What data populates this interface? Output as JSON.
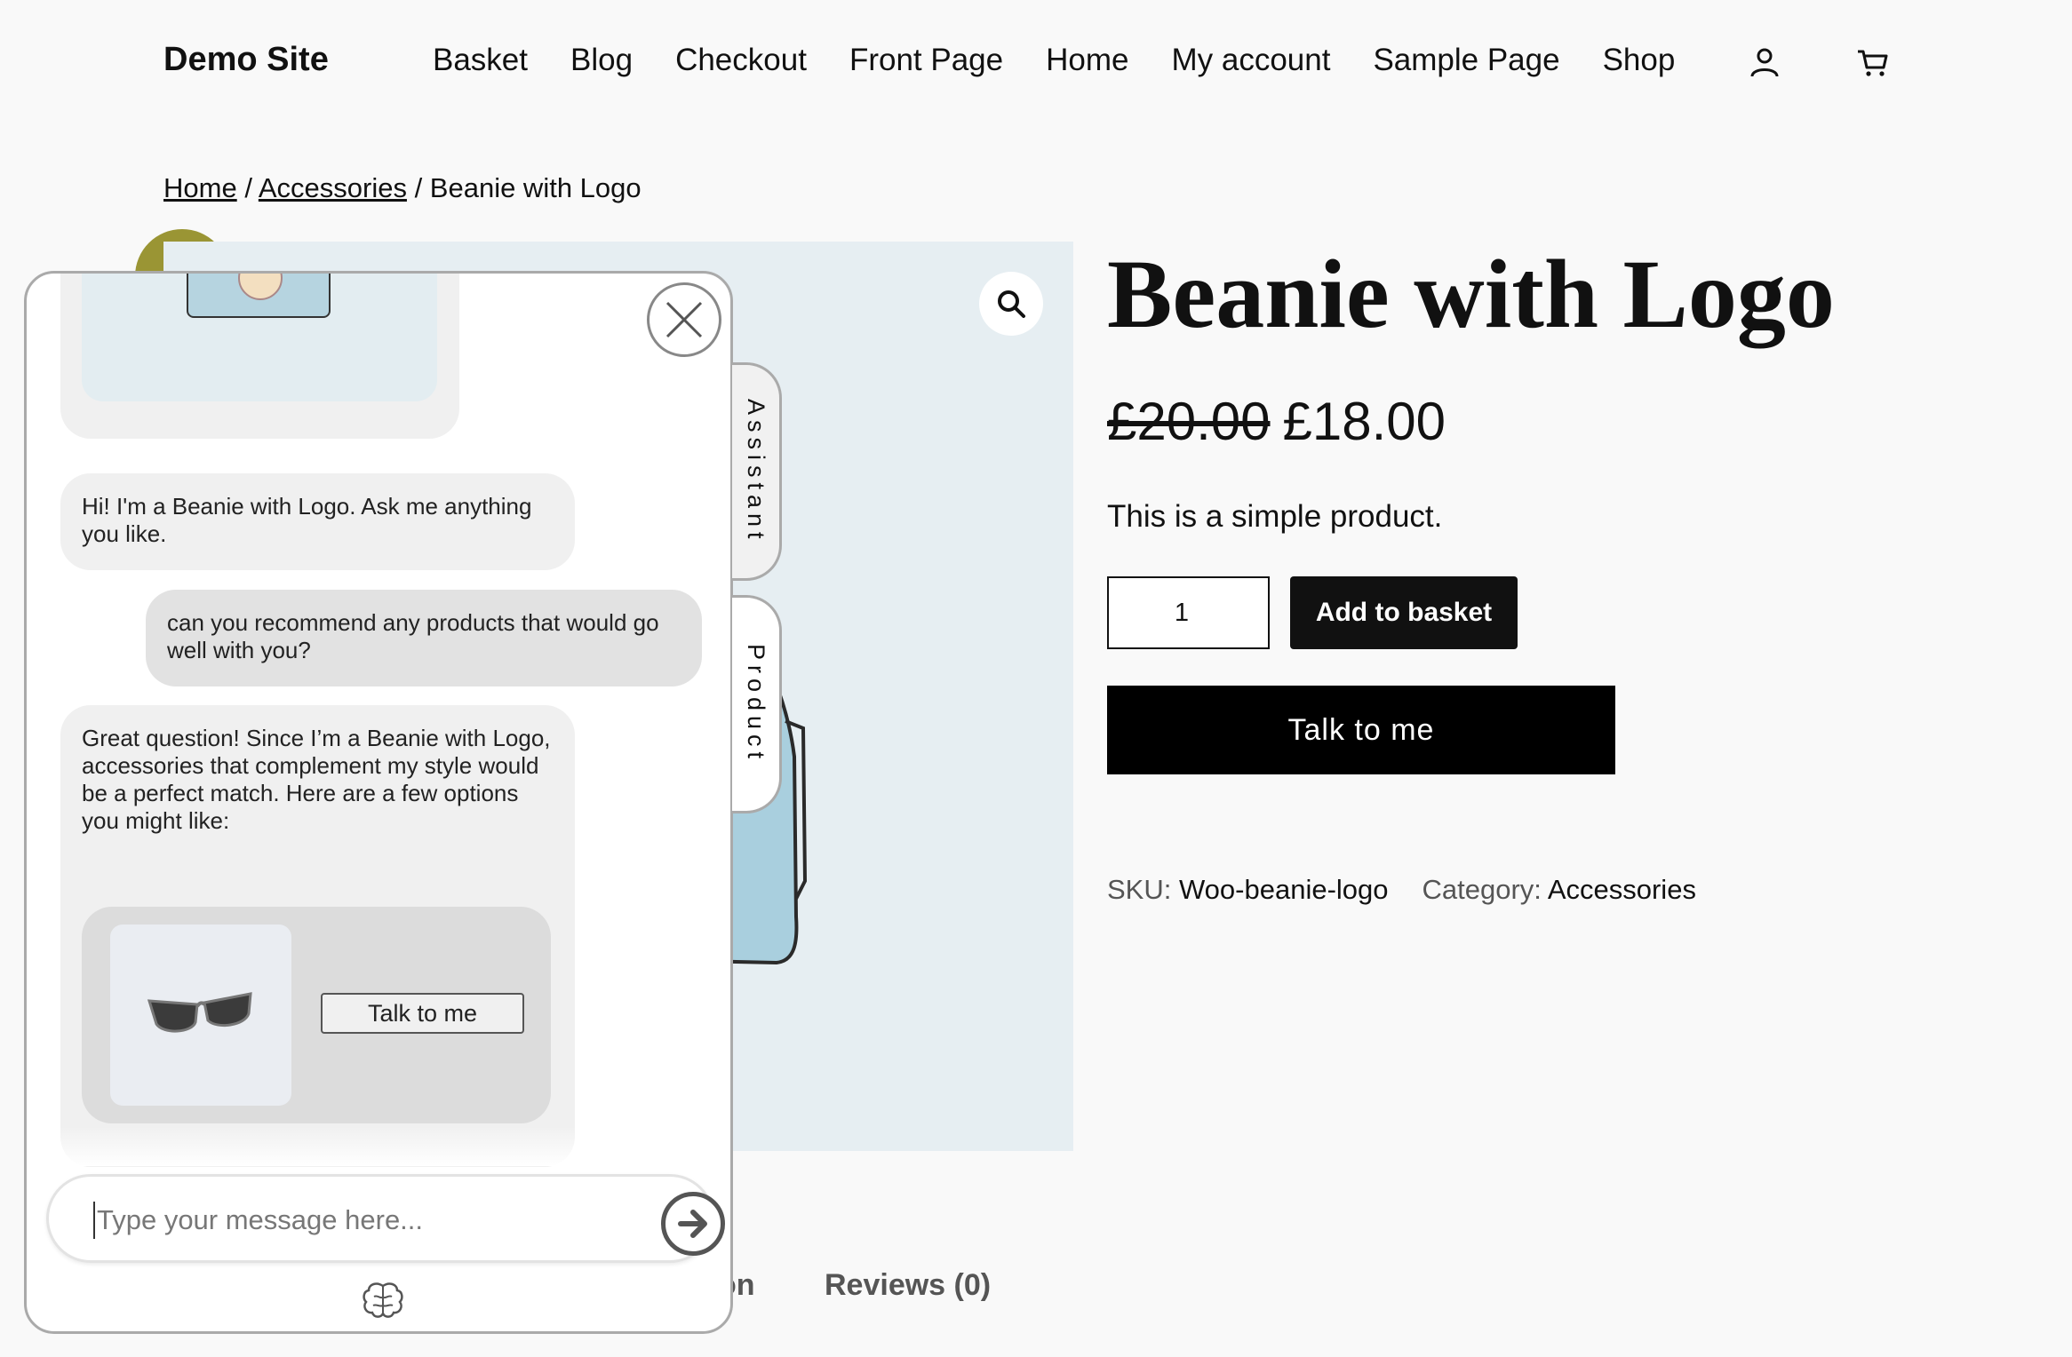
{
  "header": {
    "site_title": "Demo Site",
    "nav": [
      "Basket",
      "Blog",
      "Checkout",
      "Front Page",
      "Home",
      "My account",
      "Sample Page",
      "Shop"
    ],
    "account_icon": "user-icon",
    "cart_icon": "cart-icon"
  },
  "breadcrumb": {
    "home": "Home",
    "sep1": " / ",
    "category": "Accessories",
    "sep2": " / ",
    "current": "Beanie with Logo"
  },
  "product": {
    "title": "Beanie with Logo",
    "old_price": "£20.00",
    "price": "£18.00",
    "short_description": "This is a simple product.",
    "quantity": "1",
    "add_to_basket": "Add to basket",
    "talk_button": "Talk to me",
    "sku_label": "SKU:",
    "sku": "Woo-beanie-logo",
    "category_label": "Category:",
    "category": "Accessories"
  },
  "tabs": {
    "description_fragment": "on",
    "reviews": "Reviews (0)"
  },
  "chat": {
    "side_tabs": {
      "assistant": "Assistant",
      "product": "Product"
    },
    "messages": [
      {
        "role": "bot",
        "text": "Hi! I'm a Beanie with Logo. Ask me anything you like."
      },
      {
        "role": "user",
        "text": "can you recommend any products that would go well with you?"
      },
      {
        "role": "bot",
        "text": "Great question! Since I’m a Beanie with Logo, accessories that complement my style would be a perfect match. Here are a few options you might like:"
      }
    ],
    "suggestion_button": "Talk to me",
    "input_placeholder": "Type your message here...",
    "icons": {
      "close": "close-icon",
      "send": "arrow-right-icon",
      "brain": "brain-icon",
      "zoom": "search-icon"
    }
  }
}
